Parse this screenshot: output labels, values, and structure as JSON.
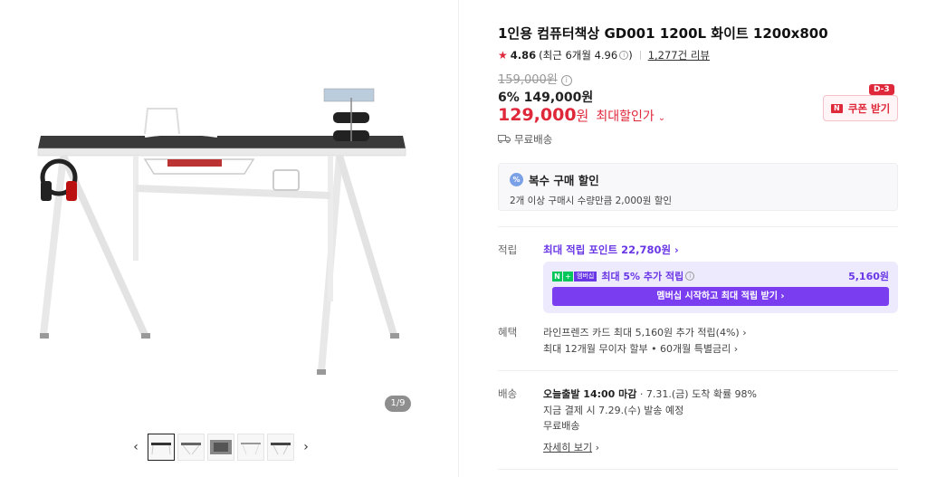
{
  "gallery": {
    "counter": "1/9",
    "prev_icon": "chevron-left-icon",
    "next_icon": "chevron-right-icon"
  },
  "product": {
    "title": "1인용 컴퓨터책상 GD001 1200L 화이트 1200x800",
    "rating": "4.86",
    "rating_recent": "(최근 6개월 4.96",
    "rating_close": ")",
    "reviews": "1,277건 리뷰",
    "original_price": "159,000원",
    "discount_line": "6% 149,000원",
    "final_price": "129,000",
    "final_won": "원",
    "max_discount_label": "최대할인가",
    "shipping": "무료배송"
  },
  "coupon": {
    "label": "쿠폰 받기",
    "dday": "D-3",
    "badge": "N"
  },
  "multi_purchase": {
    "title": "복수 구매 할인",
    "desc": "2개 이상 구매시 수량만큼 2,000원 할인",
    "icon": "%"
  },
  "points": {
    "label": "적립",
    "link": "최대 적립 포인트 22,780원",
    "member_badge_n": "N",
    "member_badge_plus": "+",
    "member_badge_text": "멤버십",
    "member_extra": "최대 5% 추가 적립",
    "member_amount": "5,160원",
    "member_button": "멤버십 시작하고 최대 적립 받기 ›"
  },
  "benefits": {
    "label": "혜택",
    "line1": "라인프렌즈 카드 최대 5,160원 추가 적립(4%)",
    "line2": "최대 12개월 무이자 할부 • 60개월 특별금리"
  },
  "delivery": {
    "label": "배송",
    "line1_bold": "오늘출발 14:00 마감",
    "line1_rest": "· 7.31.(금) 도착 확률 98%",
    "line2": "지금 결제 시 7.29.(수) 발송 예정",
    "line3": "무료배송",
    "detail": "자세히 보기"
  },
  "colors": {
    "accent_red": "#e0283b",
    "accent_purple": "#6a37e6",
    "naver_green": "#03c75a"
  }
}
